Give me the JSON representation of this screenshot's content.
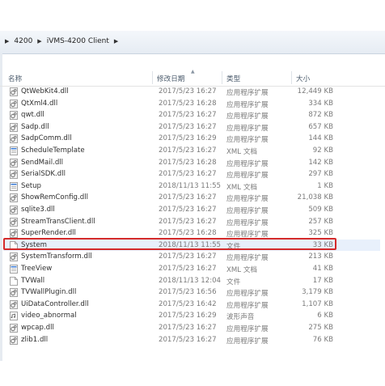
{
  "breadcrumb": {
    "items": [
      "4200",
      "iVMS-4200 Client"
    ]
  },
  "columns": {
    "name": "名称",
    "date": "修改日期",
    "type": "类型",
    "size": "大小"
  },
  "files": [
    {
      "name": "QtWebKit4.dll",
      "date": "2017/5/23 16:27",
      "type": "应用程序扩展",
      "size": "12,449 KB",
      "icon": "dll-gear-icon"
    },
    {
      "name": "QtXml4.dll",
      "date": "2017/5/23 16:28",
      "type": "应用程序扩展",
      "size": "334 KB",
      "icon": "dll-gear-icon"
    },
    {
      "name": "qwt.dll",
      "date": "2017/5/23 16:27",
      "type": "应用程序扩展",
      "size": "872 KB",
      "icon": "dll-gear-icon"
    },
    {
      "name": "Sadp.dll",
      "date": "2017/5/23 16:27",
      "type": "应用程序扩展",
      "size": "657 KB",
      "icon": "dll-gear-icon"
    },
    {
      "name": "SadpComm.dll",
      "date": "2017/5/23 16:29",
      "type": "应用程序扩展",
      "size": "144 KB",
      "icon": "dll-gear-icon"
    },
    {
      "name": "ScheduleTemplate",
      "date": "2017/5/23 16:27",
      "type": "XML 文档",
      "size": "92 KB",
      "icon": "xml-doc-icon"
    },
    {
      "name": "SendMail.dll",
      "date": "2017/5/23 16:28",
      "type": "应用程序扩展",
      "size": "142 KB",
      "icon": "dll-gear-icon"
    },
    {
      "name": "SerialSDK.dll",
      "date": "2017/5/23 16:27",
      "type": "应用程序扩展",
      "size": "297 KB",
      "icon": "dll-gear-icon"
    },
    {
      "name": "Setup",
      "date": "2018/11/13 11:55",
      "type": "XML 文档",
      "size": "1 KB",
      "icon": "xml-doc-icon"
    },
    {
      "name": "ShowRemConfig.dll",
      "date": "2017/5/23 16:27",
      "type": "应用程序扩展",
      "size": "21,038 KB",
      "icon": "dll-gear-icon"
    },
    {
      "name": "sqlite3.dll",
      "date": "2017/5/23 16:27",
      "type": "应用程序扩展",
      "size": "509 KB",
      "icon": "dll-gear-icon"
    },
    {
      "name": "StreamTransClient.dll",
      "date": "2017/5/23 16:27",
      "type": "应用程序扩展",
      "size": "257 KB",
      "icon": "dll-gear-icon"
    },
    {
      "name": "SuperRender.dll",
      "date": "2017/5/23 16:28",
      "type": "应用程序扩展",
      "size": "325 KB",
      "icon": "dll-gear-icon"
    },
    {
      "name": "System",
      "date": "2018/11/13 11:55",
      "type": "文件",
      "size": "33 KB",
      "icon": "blank-file-icon",
      "selected": true
    },
    {
      "name": "SystemTransform.dll",
      "date": "2017/5/23 16:27",
      "type": "应用程序扩展",
      "size": "213 KB",
      "icon": "dll-gear-icon"
    },
    {
      "name": "TreeView",
      "date": "2017/5/23 16:27",
      "type": "XML 文档",
      "size": "41 KB",
      "icon": "xml-doc-icon"
    },
    {
      "name": "TVWall",
      "date": "2018/11/13 12:04",
      "type": "文件",
      "size": "17 KB",
      "icon": "blank-file-icon"
    },
    {
      "name": "TVWallPlugin.dll",
      "date": "2017/5/23 16:56",
      "type": "应用程序扩展",
      "size": "3,179 KB",
      "icon": "dll-gear-icon"
    },
    {
      "name": "UiDataController.dll",
      "date": "2017/5/23 16:42",
      "type": "应用程序扩展",
      "size": "1,107 KB",
      "icon": "dll-gear-icon"
    },
    {
      "name": "video_abnormal",
      "date": "2017/5/23 16:29",
      "type": "波形声音",
      "size": "6 KB",
      "icon": "audio-file-icon"
    },
    {
      "name": "wpcap.dll",
      "date": "2017/5/23 16:27",
      "type": "应用程序扩展",
      "size": "275 KB",
      "icon": "dll-gear-icon"
    },
    {
      "name": "zlib1.dll",
      "date": "2017/5/23 16:27",
      "type": "应用程序扩展",
      "size": "76 KB",
      "icon": "dll-gear-icon"
    }
  ],
  "highlight_color": "#d42a2a"
}
